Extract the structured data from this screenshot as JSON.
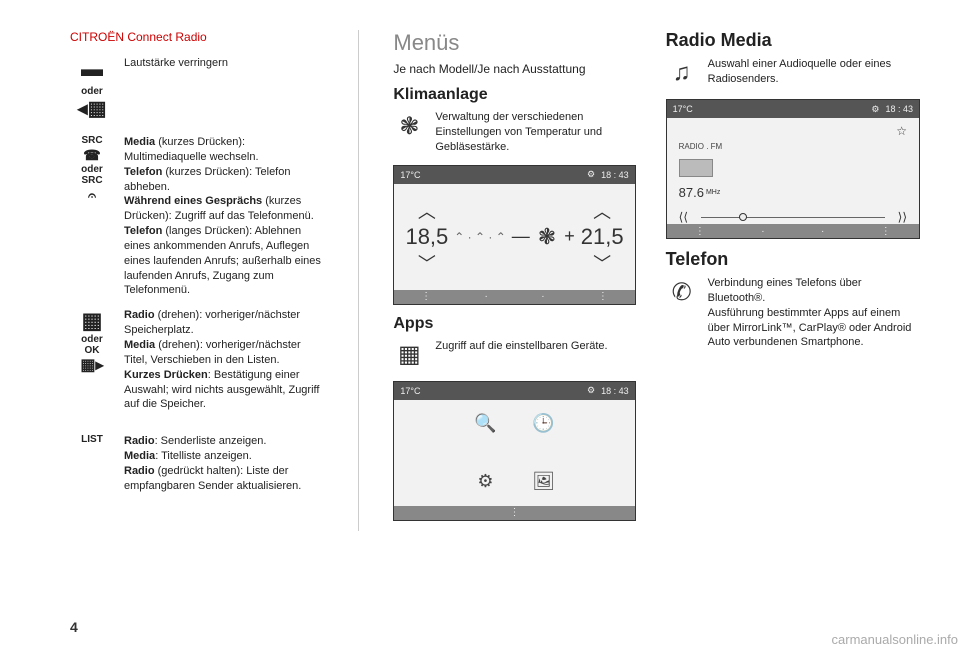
{
  "meta": {
    "page_number": "4",
    "header": "CITROËN Connect Radio",
    "watermark": "carmanualsonline.info"
  },
  "col1": {
    "vol_down": "Lautstärke verringern",
    "or1": "oder",
    "src_label": "SRC",
    "or2": "oder",
    "src2_label": "SRC",
    "media_short_title": "Media",
    "media_short_note": " (kurzes Drücken): Multimediaquelle wechseln.",
    "tel_short_title": "Telefon",
    "tel_short_note": " (kurzes Drücken): Telefon abheben.",
    "during_call_title": "Während eines Gesprächs",
    "during_call_note": " (kurzes Drücken): Zugriff auf das Telefonmenü.",
    "tel_long_title": "Telefon",
    "tel_long_note": " (langes Drücken): Ablehnen eines ankommenden Anrufs, Auflegen eines laufenden Anrufs; außerhalb eines laufenden Anrufs, Zugang zum Telefonmenü.",
    "or3": "oder",
    "ok_label": "OK",
    "radio_rotate_title": "Radio",
    "radio_rotate_note": " (drehen): vorheriger/nächster Speicherplatz.",
    "media_rotate_title": "Media",
    "media_rotate_note": " (drehen): vorheriger/nächster Titel, Verschieben in den Listen.",
    "short_press_title": "Kurzes Drücken",
    "short_press_note": ": Bestätigung einer Auswahl; wird nichts ausgewählt, Zugriff auf die Speicher.",
    "list_label": "LIST",
    "radio_list_title": "Radio",
    "radio_list_note": ": Senderliste anzeigen.",
    "media_list_title": "Media",
    "media_list_note": ": Titelliste anzeigen.",
    "radio_hold_title": "Radio",
    "radio_hold_note": " (gedrückt halten): Liste der empfangbaren Sender aktualisieren."
  },
  "col2": {
    "title": "Menüs",
    "subtitle": "Je nach Modell/Je nach Ausstattung",
    "klima_heading": "Klimaanlage",
    "klima_desc": "Verwaltung der verschiedenen Einstellungen von Temperatur und Gebläsestärke.",
    "klima_screen": {
      "temp_label": "17°C",
      "clock": "18 : 43",
      "left_temp": "18,5",
      "right_temp": "21,5"
    },
    "apps_heading": "Apps",
    "apps_desc": "Zugriff auf die einstellbaren Geräte.",
    "apps_screen": {
      "temp_label": "17°C",
      "clock": "18 : 43"
    }
  },
  "col3": {
    "radio_heading": "Radio Media",
    "radio_desc": "Auswahl einer Audioquelle oder eines Radiosenders.",
    "radio_screen": {
      "temp_label": "17°C",
      "clock": "18 : 43",
      "source": "RADIO . FM",
      "freq": "87.6",
      "unit": "MHz"
    },
    "phone_heading": "Telefon",
    "phone_desc": "Verbindung eines Telefons über Bluetooth®.\nAusführung bestimmter Apps auf einem über MirrorLink™, CarPlay® oder Android Auto verbundenen Smartphone."
  }
}
